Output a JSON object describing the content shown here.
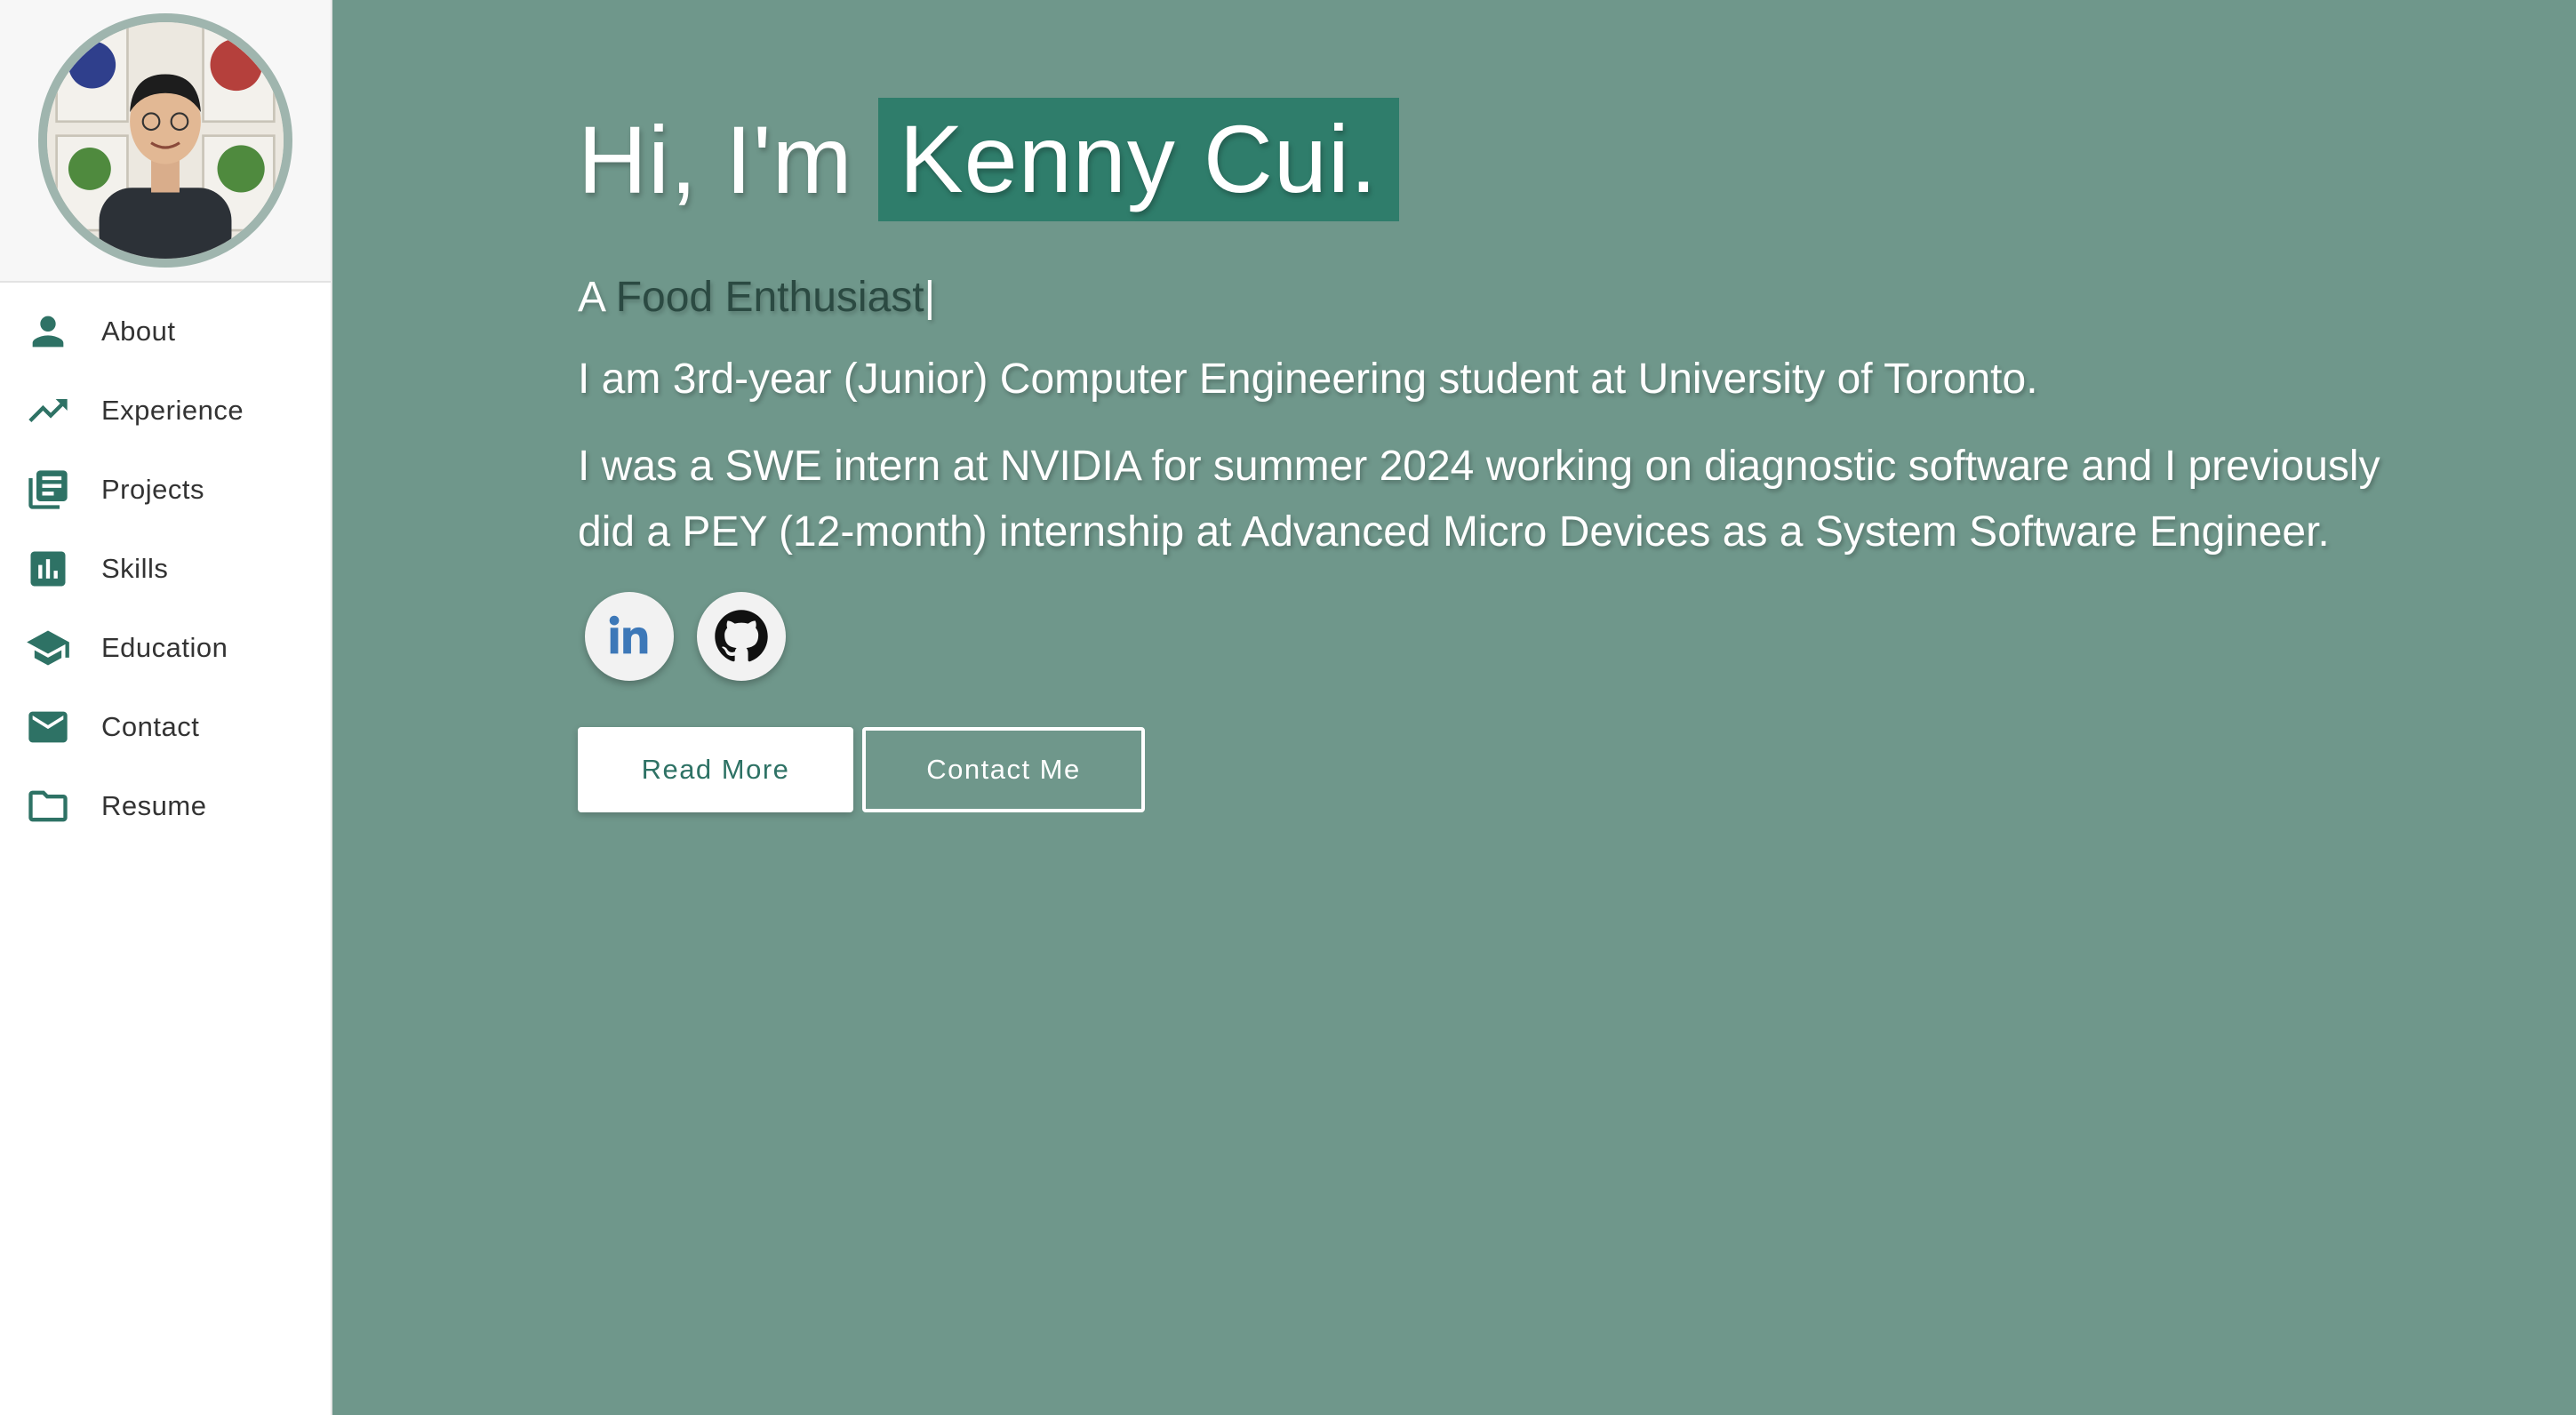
{
  "sidebar": {
    "avatar_alt": "Profile photo",
    "items": [
      {
        "label": "About",
        "icon": "person-icon"
      },
      {
        "label": "Experience",
        "icon": "trending-up-icon"
      },
      {
        "label": "Projects",
        "icon": "library-books-icon"
      },
      {
        "label": "Skills",
        "icon": "bar-chart-icon"
      },
      {
        "label": "Education",
        "icon": "school-icon"
      },
      {
        "label": "Contact",
        "icon": "mail-icon"
      },
      {
        "label": "Resume",
        "icon": "folder-icon"
      }
    ]
  },
  "hero": {
    "greeting_prefix": "Hi, I'm",
    "name": "Kenny Cui.",
    "tagline_prefix": "A",
    "tagline_typed": "Food Enthusiast",
    "tagline_cursor": "|",
    "paragraph_1": "I am 3rd-year (Junior) Computer Engineering student at University of Toronto.",
    "paragraph_2": "I was a SWE intern at NVIDIA for summer 2024 working on diagnostic software and I previously did a PEY (12-month) internship at Advanced Micro Devices as a System Software Engineer.",
    "socials": [
      {
        "name": "LinkedIn",
        "icon": "linkedin-icon"
      },
      {
        "name": "GitHub",
        "icon": "github-icon"
      }
    ],
    "read_more_label": "Read More",
    "contact_label": "Contact Me"
  },
  "colors": {
    "main_background": "#6f978b",
    "accent": "#2e7265",
    "name_highlight": "#2f7d6b",
    "typed_text": "#2b4a42"
  }
}
